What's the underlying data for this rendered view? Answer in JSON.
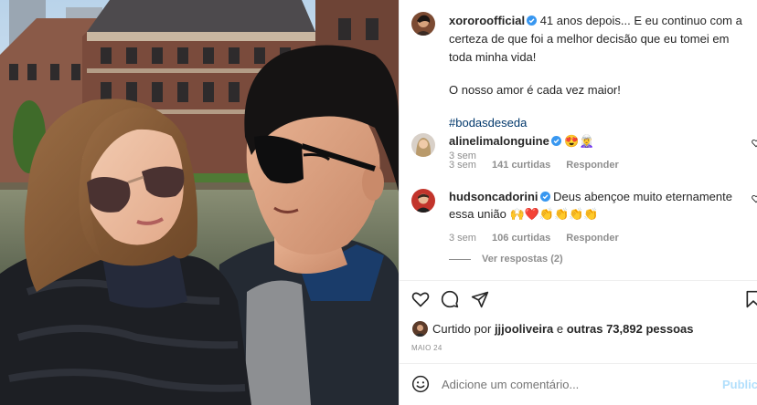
{
  "post": {
    "author": "xororoofficial",
    "caption_line1": "41 anos depois... E eu continuo com a certeza de que foi a melhor decisão que eu tomei em toda minha vida!",
    "caption_line2": "O nosso amor é cada vez maior!",
    "hashtag": "#bodasdeseda",
    "time_ago": "3 sem"
  },
  "comments": [
    {
      "author": "alinelimalonguine",
      "text": "😍🧝‍♀️",
      "time_ago": "3 sem",
      "likes": "141 curtidas",
      "reply_label": "Responder"
    },
    {
      "author": "hudsoncadorini",
      "text": "Deus abençoe muito eternamente essa união 🙌❤️👏👏👏👏",
      "time_ago": "3 sem",
      "likes": "106 curtidas",
      "reply_label": "Responder"
    }
  ],
  "view_replies": "Ver respostas (2)",
  "likes_summary": {
    "prefix": "Curtido por",
    "user": "jjjooliveira",
    "middle": "e",
    "others": "outras 73,892 pessoas"
  },
  "date": "MAIO 24",
  "comment_input": {
    "placeholder": "Adicione um comentário...",
    "publish_label": "Publicar"
  },
  "icons": {
    "verified": "verified-badge-icon",
    "like": "heart-icon",
    "comment": "comment-icon",
    "share": "share-icon",
    "save": "bookmark-icon",
    "emoji": "emoji-icon"
  },
  "colors": {
    "verified": "#3897f0",
    "hashtag": "#00376b",
    "muted": "#8e8e8e",
    "publish": "#b2dffc"
  }
}
